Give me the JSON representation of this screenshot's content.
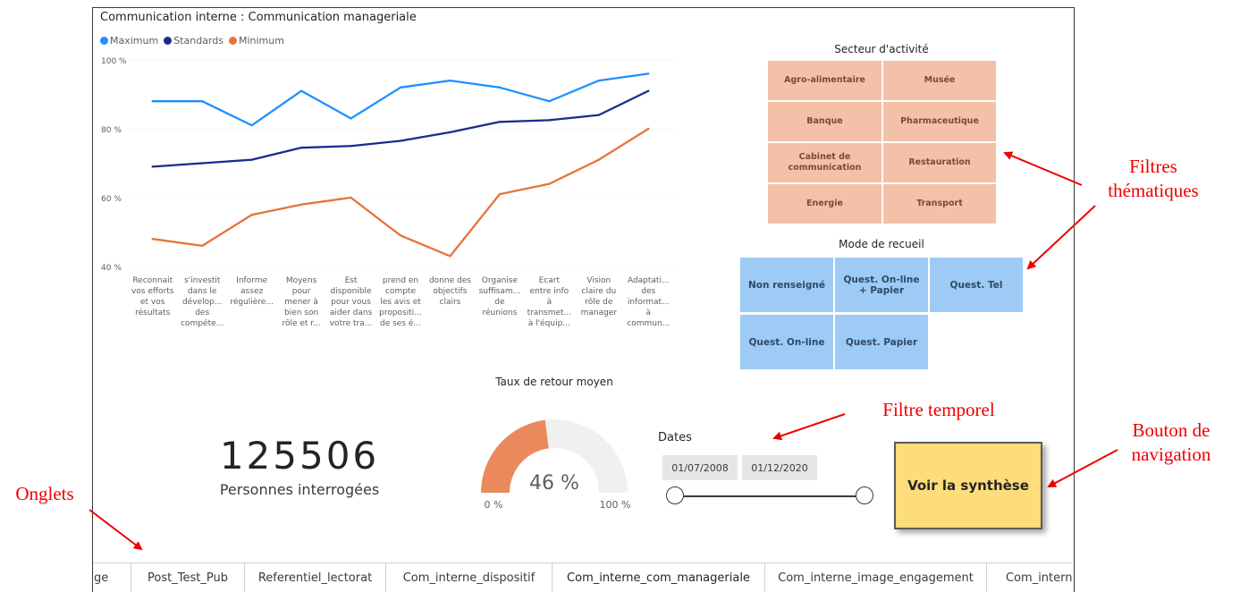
{
  "report": {
    "chart_title": "Communication interne : Communication manageriale",
    "legend": [
      {
        "name": "Maximum",
        "color": "#1e90ff"
      },
      {
        "name": "Standards",
        "color": "#1a2d8c"
      },
      {
        "name": "Minimum",
        "color": "#e8733a"
      }
    ]
  },
  "chart_data": {
    "type": "line",
    "title": "Communication interne : Communication manageriale",
    "ylim": [
      40,
      100
    ],
    "y_ticks": [
      "100 %",
      "80 %",
      "60 %",
      "40 %"
    ],
    "categories": [
      [
        "Reconnait",
        "vos efforts",
        "et vos",
        "résultats"
      ],
      [
        "s'investit",
        "dans le",
        "dévelop...",
        "des",
        "compéte..."
      ],
      [
        "Informe",
        "assez",
        "régulière..."
      ],
      [
        "Moyens",
        "pour",
        "mener à",
        "bien son",
        "rôle et r..."
      ],
      [
        "Est",
        "disponible",
        "pour vous",
        "aider dans",
        "votre tra..."
      ],
      [
        "prend en",
        "compte",
        "les avis et",
        "propositi...",
        "de ses é..."
      ],
      [
        "donne des",
        "objectifs",
        "clairs"
      ],
      [
        "Organise",
        "suffisam...",
        "de",
        "réunions"
      ],
      [
        "Ecart",
        "entre info",
        "à",
        "transmet...",
        "à l'équip..."
      ],
      [
        "Vision",
        "claire du",
        "rôle de",
        "manager"
      ],
      [
        "Adaptati...",
        "des",
        "informat...",
        "à",
        "commun..."
      ]
    ],
    "series": [
      {
        "name": "Maximum",
        "color": "#1e90ff",
        "values": [
          88,
          88,
          81,
          91,
          83,
          92,
          94,
          92,
          88,
          94,
          96
        ]
      },
      {
        "name": "Standards",
        "color": "#1a2d8c",
        "values": [
          69,
          70,
          71,
          74.5,
          75,
          76.5,
          79,
          82,
          82.5,
          84,
          91
        ]
      },
      {
        "name": "Minimum",
        "color": "#e8733a",
        "values": [
          48,
          46,
          55,
          58,
          60,
          49,
          43,
          61,
          64,
          71,
          80
        ]
      }
    ]
  },
  "secteur": {
    "title": "Secteur d'activité",
    "items": [
      "Agro-alimentaire",
      "Musée",
      "Banque",
      "Pharmaceutique",
      "Cabinet de communication",
      "Restauration",
      "Energie",
      "Transport"
    ],
    "color": "#f3c1a8"
  },
  "mode": {
    "title": "Mode de recueil",
    "items": [
      "Non renseigné",
      "Quest. On-line + Papier",
      "Quest. Tel",
      "Quest. On-line",
      "Quest. Papier"
    ],
    "color": "#9ecbf5"
  },
  "kpi": {
    "value": "125506",
    "label": "Personnes interrogées"
  },
  "gauge": {
    "title": "Taux de retour moyen",
    "value": 46,
    "value_label": "46 %",
    "min_label": "0 %",
    "max_label": "100 %",
    "color": "#ea8a5c"
  },
  "dates": {
    "title": "Dates",
    "start": "01/07/2008",
    "end": "01/12/2020"
  },
  "nav_button": {
    "label": "Voir la synthèse",
    "color": "#fddc7c"
  },
  "tabs": [
    "ge",
    "Post_Test_Pub",
    "Referentiel_lectorat",
    "Com_interne_dispositif",
    "Com_interne_com_manageriale",
    "Com_interne_image_engagement",
    "Com_interne"
  ],
  "active_tab": "Com_interne_com_manageriale",
  "annotations": {
    "filtres_1": "Filtres",
    "filtres_2": "thématiques",
    "temporel": "Filtre temporel",
    "bouton_1": "Bouton de",
    "bouton_2": "navigation",
    "onglets": "Onglets"
  }
}
